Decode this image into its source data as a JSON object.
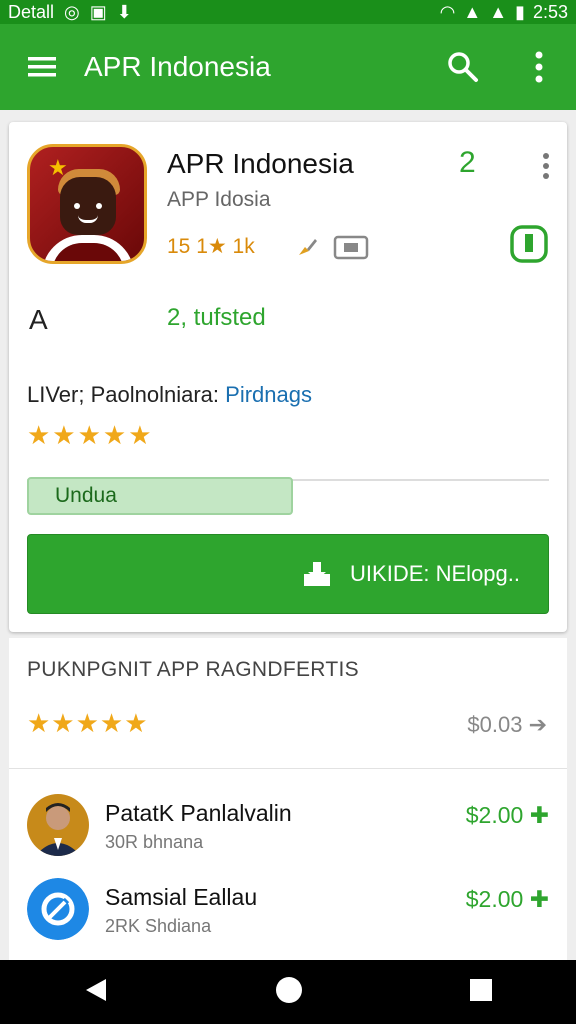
{
  "status_bar": {
    "label": "Detall",
    "time": "2:53"
  },
  "app_bar": {
    "title": "APR Indonesia"
  },
  "app": {
    "name": "APR Indonesia",
    "developer": "APP Idosia",
    "meta": "15 1★ 1k",
    "number": "2",
    "age": "A",
    "trusted": "2, tufsted",
    "info_label": "LIVer; Paolnolniara:",
    "info_link": "Pirdnags",
    "rating_stars": "★★★★★",
    "progress": {
      "label": "Undua",
      "fraction": 0.51
    },
    "install_label": "UIKIDE: NElopg.."
  },
  "section": {
    "title": "PUKNPGNIT APP RAGNDFERTIS",
    "stars": "★★★★★",
    "price": "$0.03"
  },
  "rows": [
    {
      "name": "PatatK Panlalvalin",
      "sub": "30R bhnana",
      "price": "$2.00"
    },
    {
      "name": "Samsial Eallau",
      "sub": "2RK Shdiana",
      "price": "$2.00"
    }
  ],
  "colors": {
    "primary": "#2ea52e",
    "status": "#1a8f1a",
    "star": "#f0a81a",
    "link": "#1a6fb0"
  }
}
